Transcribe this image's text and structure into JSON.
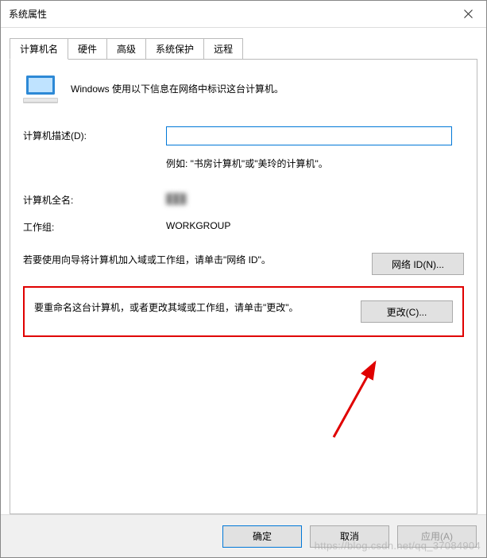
{
  "window": {
    "title": "系统属性"
  },
  "tabs": {
    "computer_name": "计算机名",
    "hardware": "硬件",
    "advanced": "高级",
    "system_protection": "系统保护",
    "remote": "远程"
  },
  "panel": {
    "intro": "Windows 使用以下信息在网络中标识这台计算机。",
    "desc_label": "计算机描述(D):",
    "desc_value": "",
    "example": "例如: \"书房计算机\"或\"美玲的计算机\"。",
    "fullname_label": "计算机全名:",
    "fullname_value": "███",
    "workgroup_label": "工作组:",
    "workgroup_value": "WORKGROUP",
    "network_id_text": "若要使用向导将计算机加入域或工作组，请单击\"网络 ID\"。",
    "network_id_button": "网络 ID(N)...",
    "change_text": "要重命名这台计算机，或者更改其域或工作组，请单击\"更改\"。",
    "change_button": "更改(C)..."
  },
  "buttons": {
    "ok": "确定",
    "cancel": "取消",
    "apply": "应用(A)"
  },
  "watermark": "https://blog.csdn.net/qq_37084904"
}
